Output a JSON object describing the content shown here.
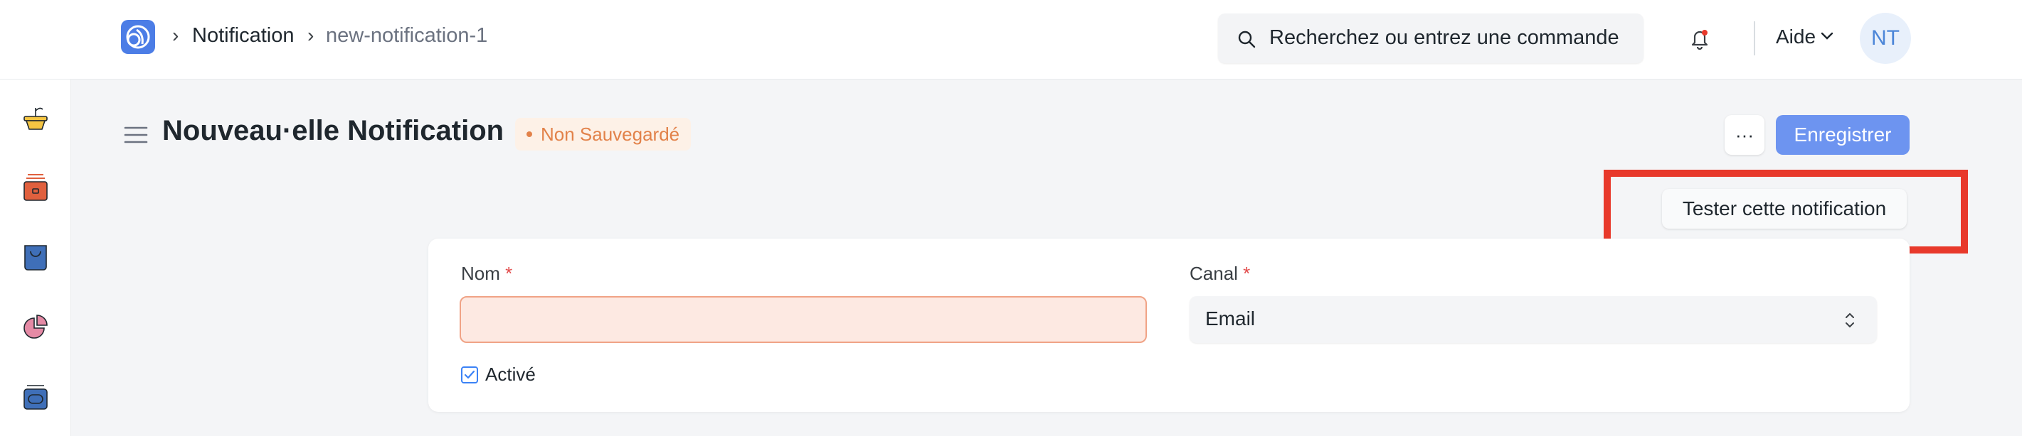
{
  "breadcrumb": {
    "items": [
      "Notification",
      "new-notification-1"
    ]
  },
  "search": {
    "placeholder": "Recherchez ou entrez une commande"
  },
  "navbar": {
    "help_label": "Aide",
    "avatar_initials": "NT"
  },
  "sidebar": {
    "icons": [
      "plant-pot-icon",
      "stacked-box-icon",
      "bag-icon",
      "pie-chart-icon",
      "stack-icon"
    ]
  },
  "page": {
    "title": "Nouveau·elle Notification",
    "status": "Non Sauvegardé",
    "menu_label": "···",
    "save_label": "Enregistrer",
    "test_label": "Tester cette notification"
  },
  "form": {
    "name_label": "Nom",
    "name_value": "",
    "channel_label": "Canal",
    "channel_value": "Email",
    "required_mark": "*",
    "enabled_label": "Activé",
    "enabled_checked": true
  },
  "colors": {
    "accent": "#6d94f0",
    "status_orange": "#e2824a",
    "highlight": "#e8392b",
    "error_bg": "#fde9e2"
  }
}
